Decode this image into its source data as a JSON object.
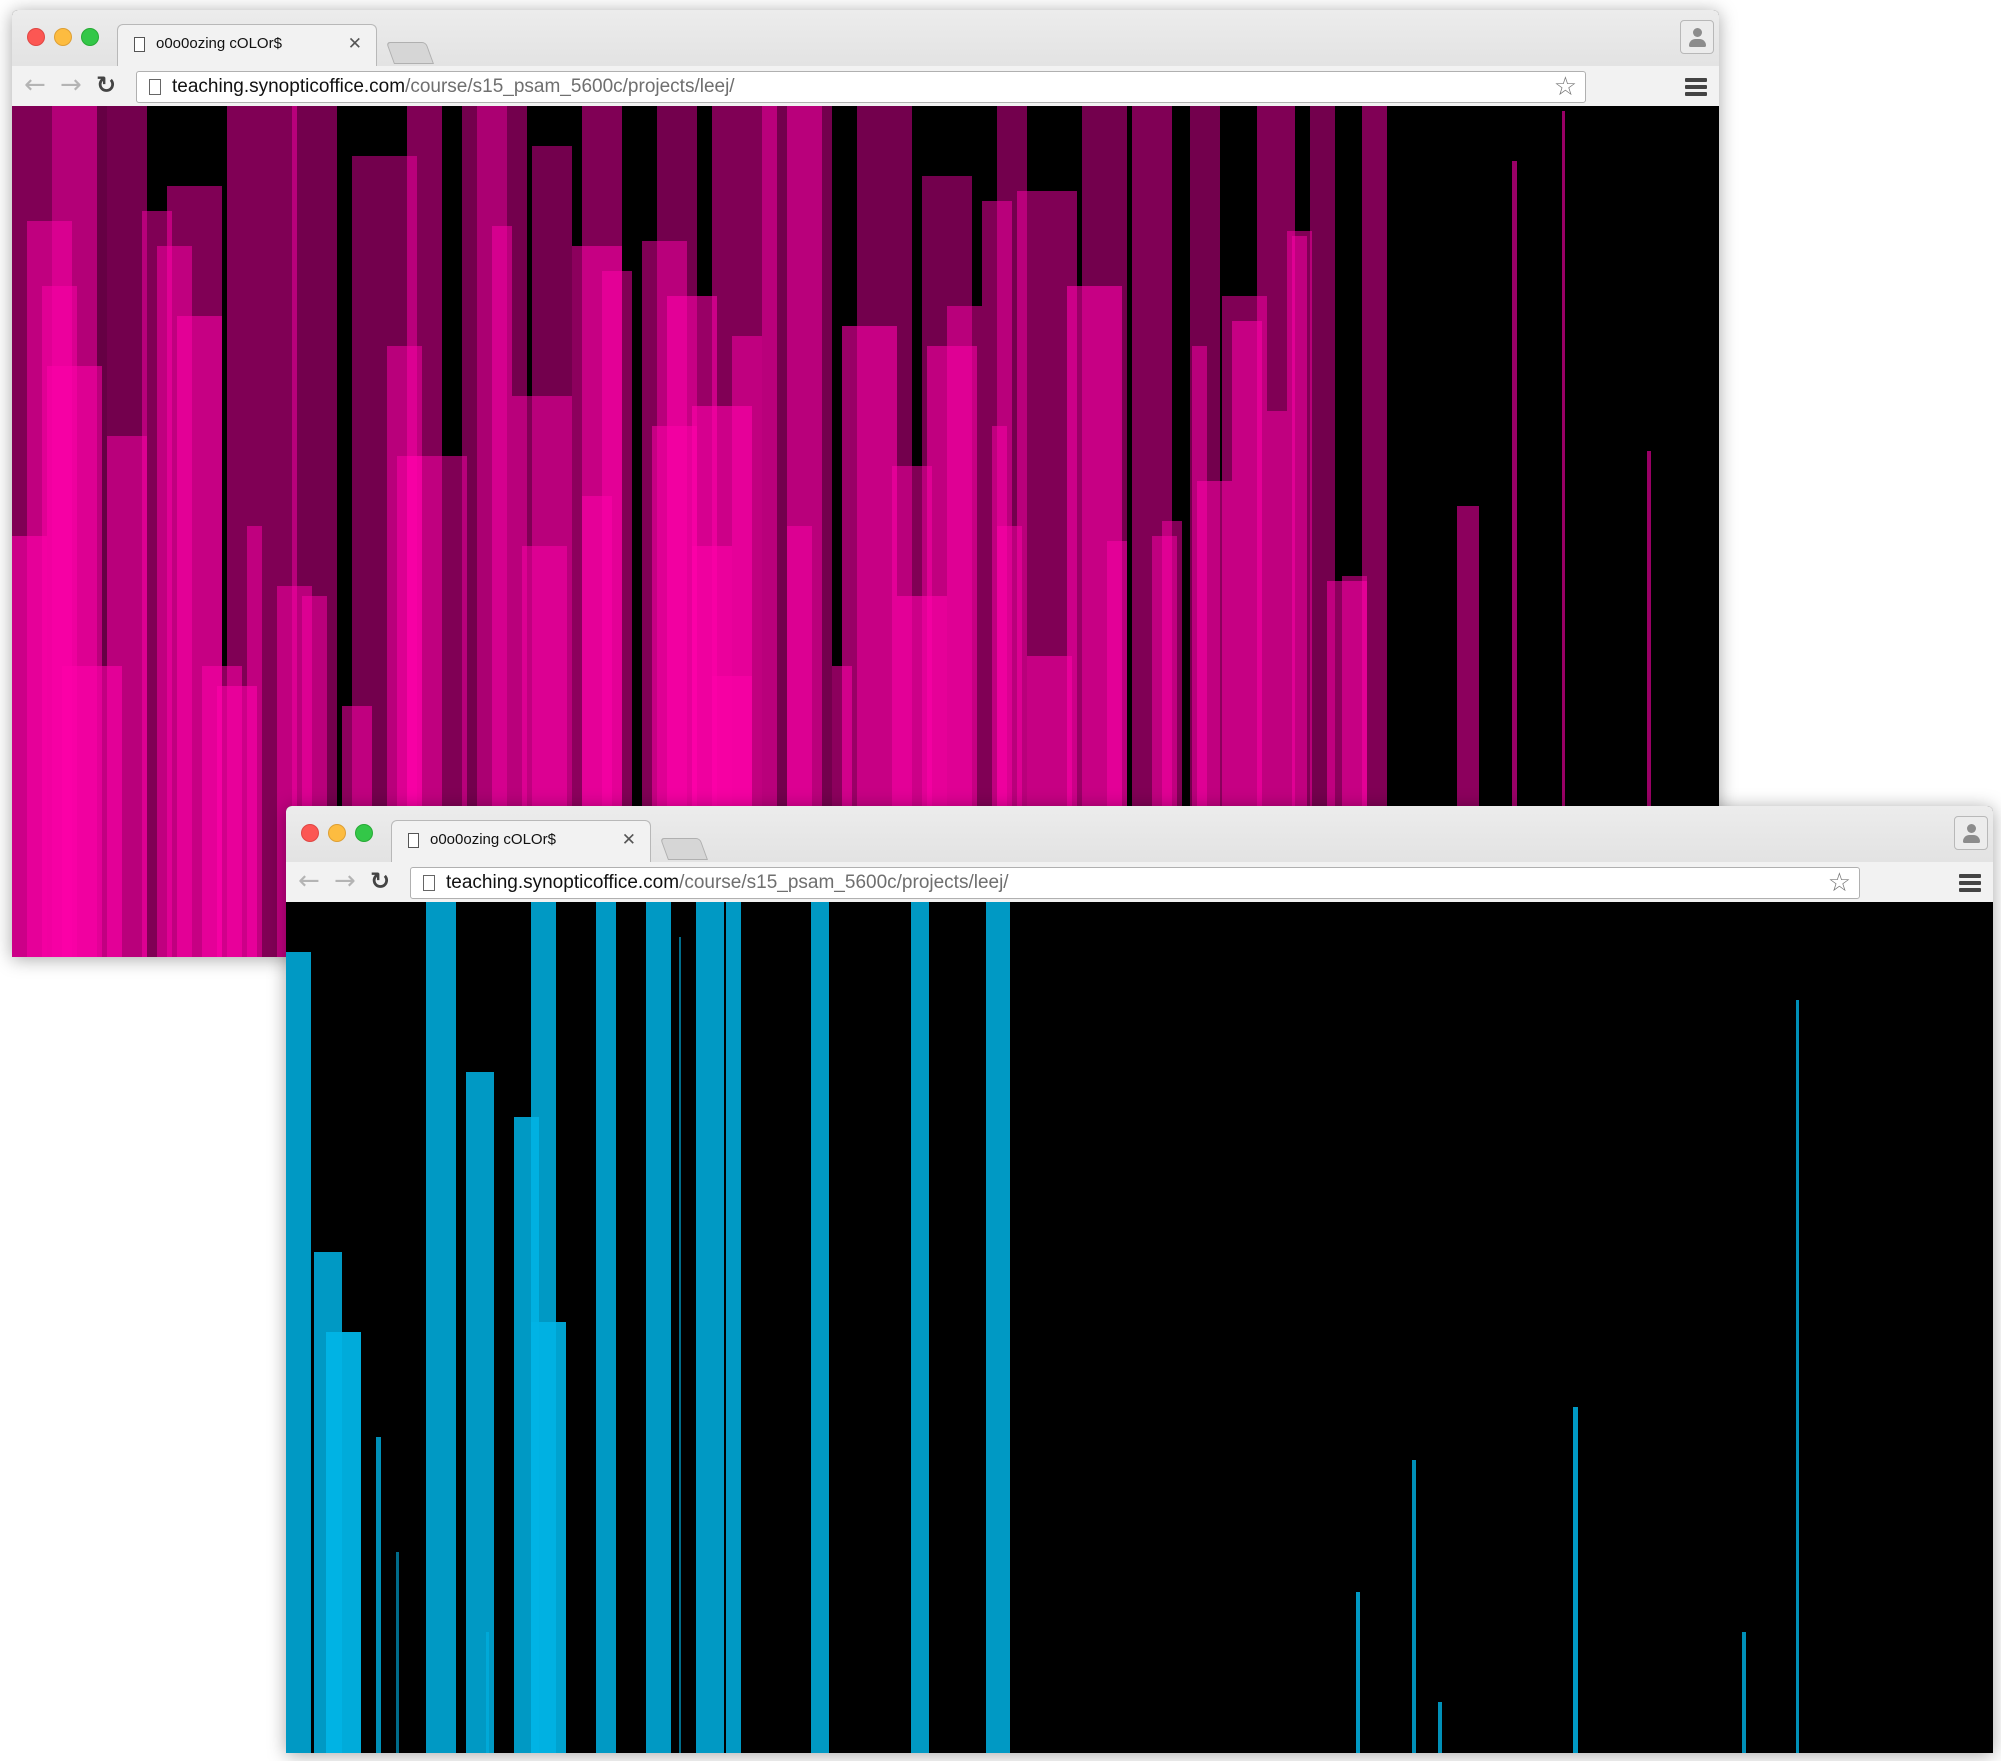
{
  "windows": [
    {
      "id": "magenta",
      "tab": {
        "title": "o0o0ozing cOLOr$"
      },
      "address": {
        "host": "teaching.synopticoffice.com",
        "path": "/course/s15_psam_5600c/projects/leej/"
      },
      "bar_color": "#ff00aa",
      "background_color": "#000000"
    },
    {
      "id": "cyan",
      "tab": {
        "title": "o0o0ozing cOLOr$"
      },
      "address": {
        "host": "teaching.synopticoffice.com",
        "path": "/course/s15_psam_5600c/projects/leej/"
      },
      "bar_color": "#00b4e6",
      "background_color": "#000000"
    }
  ],
  "icons": {
    "back": "arrow-left",
    "forward": "arrow-right",
    "reload": "reload",
    "bookmark": "star-outline",
    "menu": "hamburger",
    "profile": "person",
    "favicon": "blank-page",
    "close_tab": "x"
  }
}
